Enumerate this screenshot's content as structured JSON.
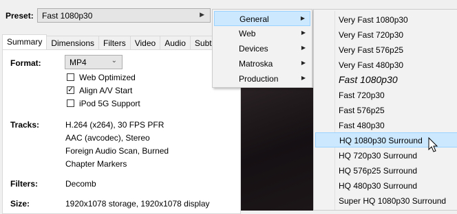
{
  "preset": {
    "label": "Preset:",
    "value": "Fast 1080p30",
    "arrow": "▶"
  },
  "tabs": [
    "Summary",
    "Dimensions",
    "Filters",
    "Video",
    "Audio",
    "Subtitle"
  ],
  "summary": {
    "format_label": "Format:",
    "format_value": "MP4",
    "checkboxes": [
      {
        "label": "Web Optimized",
        "checked": false
      },
      {
        "label": "Align A/V Start",
        "checked": true
      },
      {
        "label": "iPod 5G Support",
        "checked": false
      }
    ],
    "tracks_label": "Tracks:",
    "tracks": [
      "H.264 (x264), 30 FPS PFR",
      "AAC (avcodec), Stereo",
      "Foreign Audio Scan, Burned",
      "Chapter Markers"
    ],
    "filters_label": "Filters:",
    "filters_value": "Decomb",
    "size_label": "Size:",
    "size_value": "1920x1078 storage, 1920x1078 display"
  },
  "menu_categories": [
    {
      "label": "General",
      "highlighted": true
    },
    {
      "label": "Web",
      "highlighted": false
    },
    {
      "label": "Devices",
      "highlighted": false
    },
    {
      "label": "Matroska",
      "highlighted": false
    },
    {
      "label": "Production",
      "highlighted": false
    }
  ],
  "menu_presets": [
    {
      "label": "Very Fast 1080p30",
      "highlighted": false,
      "default": false
    },
    {
      "label": "Very Fast 720p30",
      "highlighted": false,
      "default": false
    },
    {
      "label": "Very Fast 576p25",
      "highlighted": false,
      "default": false
    },
    {
      "label": "Very Fast 480p30",
      "highlighted": false,
      "default": false
    },
    {
      "label": "Fast 1080p30",
      "highlighted": false,
      "default": true
    },
    {
      "label": "Fast 720p30",
      "highlighted": false,
      "default": false
    },
    {
      "label": "Fast 576p25",
      "highlighted": false,
      "default": false
    },
    {
      "label": "Fast 480p30",
      "highlighted": false,
      "default": false
    },
    {
      "label": "HQ 1080p30 Surround",
      "highlighted": true,
      "default": false
    },
    {
      "label": "HQ 720p30 Surround",
      "highlighted": false,
      "default": false
    },
    {
      "label": "HQ 576p25 Surround",
      "highlighted": false,
      "default": false
    },
    {
      "label": "HQ 480p30 Surround",
      "highlighted": false,
      "default": false
    },
    {
      "label": "Super HQ 1080p30 Surround",
      "highlighted": false,
      "default": false
    }
  ],
  "icons": {
    "submenu_arrow": "chevron-right-icon",
    "dropdown": "chevron-down-icon",
    "check": "checkmark-icon",
    "pointer": "mouse-pointer-icon"
  }
}
